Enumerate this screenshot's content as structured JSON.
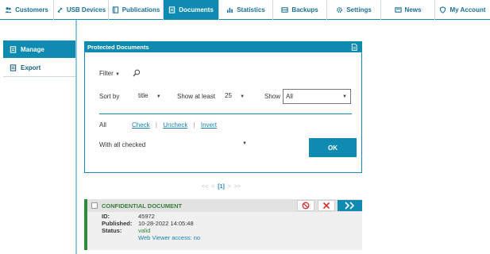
{
  "nav": {
    "tabs": [
      {
        "label": "Customers",
        "icon": "users-icon"
      },
      {
        "label": "USB Devices",
        "icon": "usb-icon"
      },
      {
        "label": "Publications",
        "icon": "book-icon"
      },
      {
        "label": "Documents",
        "icon": "document-icon",
        "active": true
      },
      {
        "label": "Statistics",
        "icon": "bar-chart-icon"
      },
      {
        "label": "Backups",
        "icon": "backup-icon"
      },
      {
        "label": "Settings",
        "icon": "gear-icon"
      },
      {
        "label": "News",
        "icon": "news-icon"
      },
      {
        "label": "My Account",
        "icon": "shield-icon"
      }
    ]
  },
  "sidebar": {
    "items": [
      {
        "label": "Manage",
        "icon": "manage-document-icon",
        "active": true
      },
      {
        "label": "Export",
        "icon": "export-document-icon"
      }
    ]
  },
  "panel": {
    "title": "Protected Documents",
    "filter_label": "Filter",
    "sort_by_label": "Sort by",
    "sort_value": "title",
    "show_at_least_label": "Show at least",
    "show_at_least_value": "25",
    "show_label": "Show",
    "show_value": "All",
    "all_label": "All",
    "check_label": "Check",
    "uncheck_label": "Uncheck",
    "invert_label": "Invert",
    "action_value": "With all checked",
    "ok_label": "OK"
  },
  "pager": {
    "first": "<<",
    "prev": "<",
    "current": "[1]",
    "next": ">",
    "last": ">>"
  },
  "document": {
    "title": "CONFIDENTIAL DOCUMENT",
    "id_label": "ID:",
    "id_value": "45972",
    "published_label": "Published:",
    "published_value": "10-28-2022 14:05:48",
    "status_label": "Status:",
    "status_value": "valid",
    "viewer_text": "Web Viewer access: no",
    "colors": {
      "accent": "#0f8bb1",
      "status_valid": "#2e8b3a",
      "delete": "#d32f2f"
    }
  }
}
